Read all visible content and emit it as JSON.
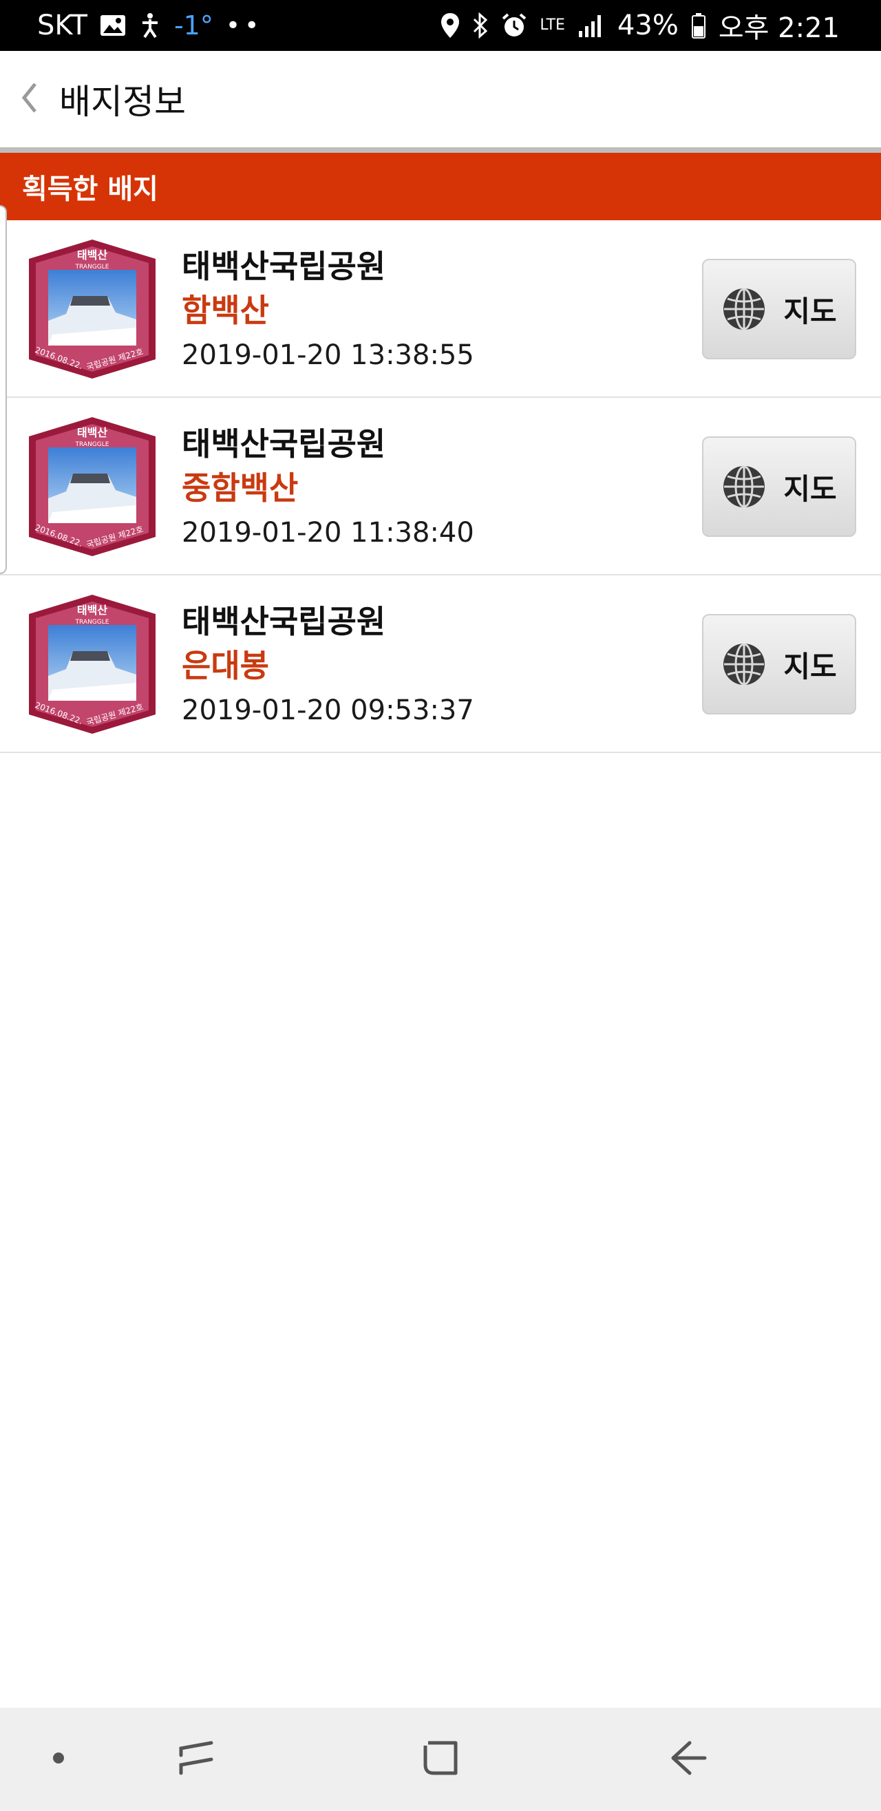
{
  "status_bar": {
    "carrier": "SKT",
    "temperature": "-1°",
    "dots": "••",
    "network": "LTE",
    "battery": "43%",
    "time": "오후 2:21",
    "icons": [
      "gallery-icon",
      "accessibility-icon",
      "location-icon",
      "bluetooth-icon",
      "alarm-icon",
      "signal-icon",
      "battery-icon"
    ]
  },
  "app_bar": {
    "back_icon": "chevron-left-icon",
    "title": "배지정보"
  },
  "section": {
    "title": "획득한 배지"
  },
  "badges": [
    {
      "park": "태백산국립공원",
      "peak": "함백산",
      "timestamp": "2019-01-20 13:38:55",
      "map_label": "지도",
      "badge_top_text": "태백산",
      "badge_brand": "TRANGGLE",
      "badge_date": "2016.08.22.",
      "badge_bottom_text": "국립공원 제22호"
    },
    {
      "park": "태백산국립공원",
      "peak": "중함백산",
      "timestamp": "2019-01-20 11:38:40",
      "map_label": "지도",
      "badge_top_text": "태백산",
      "badge_brand": "TRANGGLE",
      "badge_date": "2016.08.22.",
      "badge_bottom_text": "국립공원 제22호"
    },
    {
      "park": "태백산국립공원",
      "peak": "은대봉",
      "timestamp": "2019-01-20 09:53:37",
      "map_label": "지도",
      "badge_top_text": "태백산",
      "badge_brand": "TRANGGLE",
      "badge_date": "2016.08.22.",
      "badge_bottom_text": "국립공원 제22호"
    }
  ],
  "colors": {
    "accent": "#d63406",
    "peak_text": "#c93a10",
    "badge_frame": "#9b1a3c",
    "status_bar": "#000000",
    "nav_bar": "#efefef"
  },
  "nav_bar": {
    "icons": [
      "dot-icon",
      "recent-apps-icon",
      "home-icon",
      "back-arrow-icon"
    ]
  }
}
